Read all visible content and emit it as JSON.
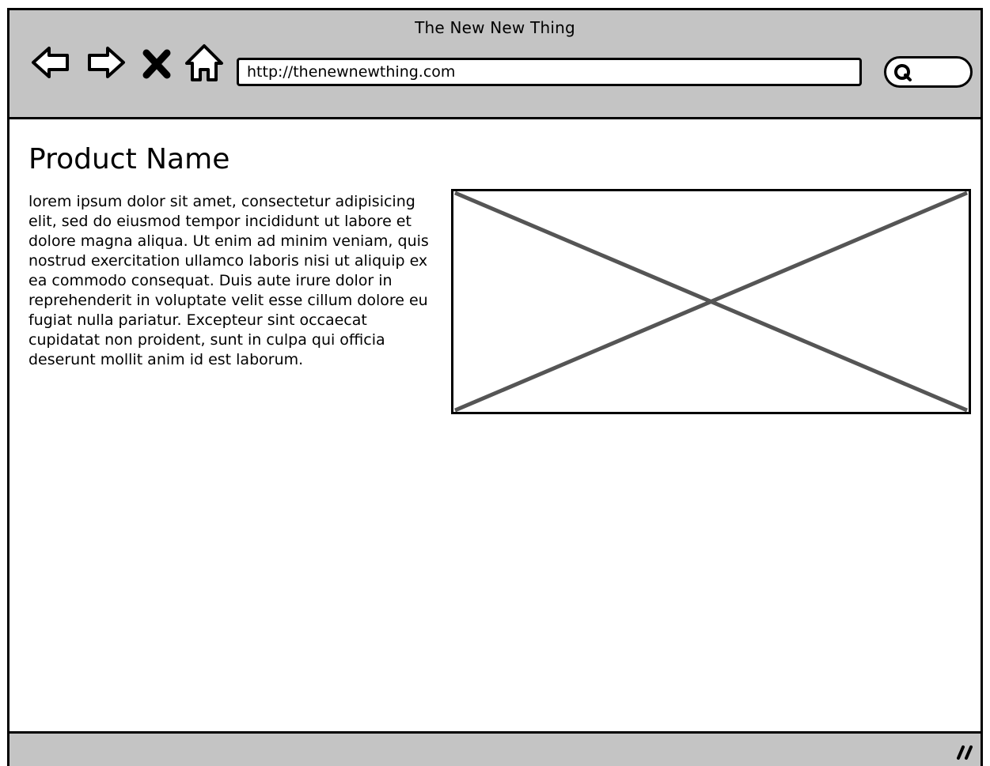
{
  "window": {
    "title": "The New New Thing"
  },
  "toolbar": {
    "back_icon": "back-arrow-icon",
    "forward_icon": "forward-arrow-icon",
    "stop_icon": "close-x-icon",
    "home_icon": "home-icon",
    "search_icon": "search-icon"
  },
  "address_bar": {
    "url": "http://thenewnewthing.com"
  },
  "content": {
    "product_name": "Product Name",
    "description": "lorem ipsum dolor sit amet, consectetur adipisicing elit, sed do eiusmod tempor incididunt ut labore et dolore magna aliqua. Ut enim ad minim veniam, quis nostrud exercitation ullamco laboris nisi ut aliquip ex ea commodo consequat. Duis aute irure dolor in reprehenderit in voluptate velit esse cillum dolore eu fugiat nulla pariatur. Excepteur sint occaecat cupidatat non proident, sunt in culpa qui officia deserunt mollit anim id est laborum.",
    "image_icon": "image-placeholder-icon"
  },
  "status_bar": {
    "grip_icon": "resize-grip-icon"
  },
  "colors": {
    "chrome": "#c4c4c4",
    "outline": "#000000",
    "placeholder_cross": "#555555"
  }
}
